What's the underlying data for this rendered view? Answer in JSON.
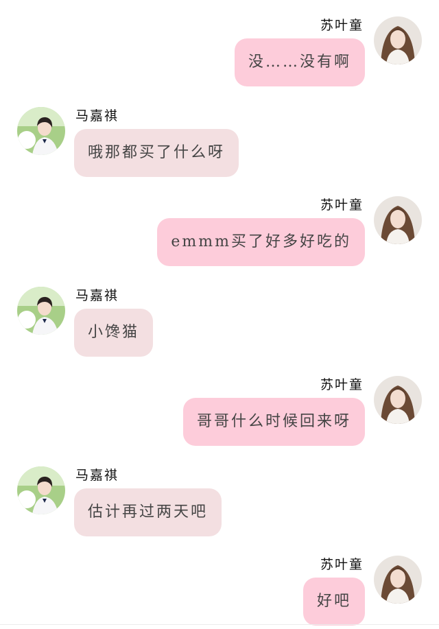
{
  "conversation": {
    "messages": [
      {
        "side": "right",
        "name": "苏叶童",
        "text": "没……没有啊"
      },
      {
        "side": "left",
        "name": "马嘉祺",
        "text": "哦那都买了什么呀"
      },
      {
        "side": "right",
        "name": "苏叶童",
        "text": "emmm买了好多好吃的"
      },
      {
        "side": "left",
        "name": "马嘉祺",
        "text": "小馋猫"
      },
      {
        "side": "right",
        "name": "苏叶童",
        "text": "哥哥什么时候回来呀"
      },
      {
        "side": "left",
        "name": "马嘉祺",
        "text": "估计再过两天吧"
      },
      {
        "side": "right",
        "name": "苏叶童",
        "text": "好吧"
      }
    ]
  },
  "colors": {
    "sent_bubble": "#fdccda",
    "received_bubble": "#f3dfe1",
    "text": "#444444"
  },
  "icons": {
    "right_avatar": "girl-portrait-avatar",
    "left_avatar": "boy-portrait-avatar"
  }
}
